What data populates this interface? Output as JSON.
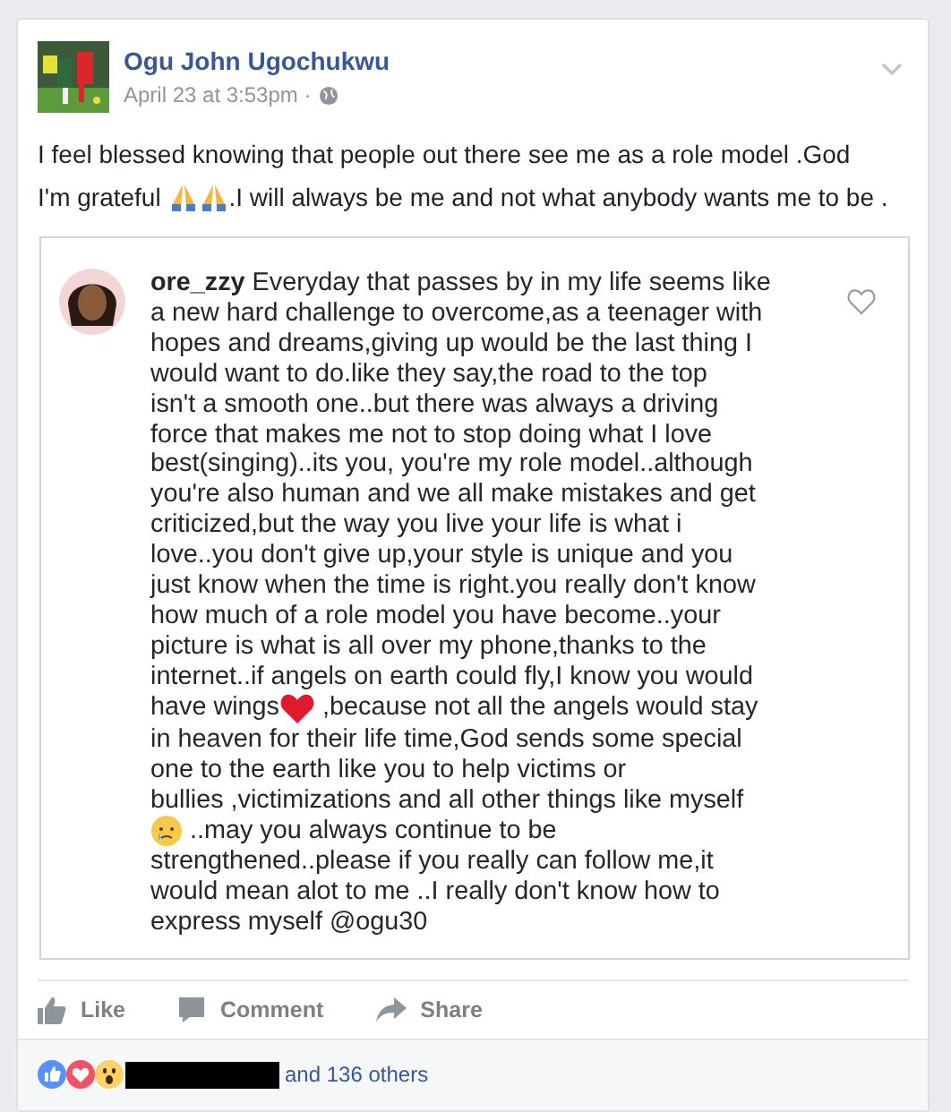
{
  "post": {
    "author": "Ogu John Ugochukwu",
    "time": "April 23 at 3:53pm ·",
    "text_lines": [
      [
        {
          "kind": "text",
          "text": "I feel blessed knowing that people out there see me as a role model .God"
        }
      ],
      [
        {
          "kind": "text",
          "text": "I'm grateful "
        },
        {
          "kind": "pray"
        },
        {
          "kind": "pray"
        },
        {
          "kind": "text",
          "text": ".I will always be me and not what anybody wants me to be ."
        }
      ]
    ]
  },
  "shared_comment": {
    "liked": false,
    "lines": [
      [
        {
          "kind": "text",
          "text": "**ore_zzy** Everyday that passes by in my life seems like"
        }
      ],
      [
        {
          "kind": "text",
          "text": "a new hard challenge to overcome,as a teenager with"
        }
      ],
      [
        {
          "kind": "text",
          "text": "hopes and dreams,giving up would be the last thing I"
        }
      ],
      [
        {
          "kind": "text",
          "text": "would want to do.like they say,the road to the top"
        }
      ],
      [
        {
          "kind": "text",
          "text": "isn't a smooth one..but there was always a driving"
        }
      ],
      [
        {
          "kind": "text",
          "text": "force that makes me not to stop doing what I love"
        }
      ],
      [
        {
          "kind": "text",
          "text": "best(singing)..its you, you're my role model..although"
        }
      ],
      [
        {
          "kind": "text",
          "text": "you're also human and we all make mistakes and get"
        }
      ],
      [
        {
          "kind": "text",
          "text": "criticized,but the way you live your life is what i"
        }
      ],
      [
        {
          "kind": "text",
          "text": "love..you don't give up,your style is unique and you"
        }
      ],
      [
        {
          "kind": "text",
          "text": "just know when the time is right.you really don't know"
        }
      ],
      [
        {
          "kind": "text",
          "text": "how much of a role model you have become..your"
        }
      ],
      [
        {
          "kind": "text",
          "text": "picture is what is all over my phone,thanks to the"
        }
      ],
      [
        {
          "kind": "text",
          "text": "internet..if angels on earth could fly,I know you would"
        }
      ],
      [
        {
          "kind": "text",
          "text": "have wings"
        },
        {
          "kind": "heart"
        },
        {
          "kind": "text",
          "text": " ,because not all the angels would stay"
        }
      ],
      [
        {
          "kind": "text",
          "text": "in heaven for their life time,God sends some special"
        }
      ],
      [
        {
          "kind": "text",
          "text": "one to the earth like you to help victims or"
        }
      ],
      [
        {
          "kind": "text",
          "text": "bullies ,victimizations and all other things like myself"
        }
      ],
      [
        {
          "kind": "sad"
        },
        {
          "kind": "text",
          "text": " ..may you always continue to be"
        }
      ],
      [
        {
          "kind": "text",
          "text": "strengthened..please if you really can follow me,it"
        }
      ],
      [
        {
          "kind": "text",
          "text": "would mean alot to me ..I really don't know how to"
        }
      ],
      [
        {
          "kind": "text",
          "text": "express myself @ogu30"
        }
      ]
    ]
  },
  "actions": [
    {
      "kind": "like",
      "label": "Like"
    },
    {
      "kind": "comment",
      "label": "Comment"
    },
    {
      "kind": "share",
      "label": "Share"
    }
  ],
  "reactions": {
    "icons": [
      {
        "kind": "like"
      },
      {
        "kind": "love"
      },
      {
        "kind": "wow"
      }
    ],
    "summary": "and 136 others"
  }
}
